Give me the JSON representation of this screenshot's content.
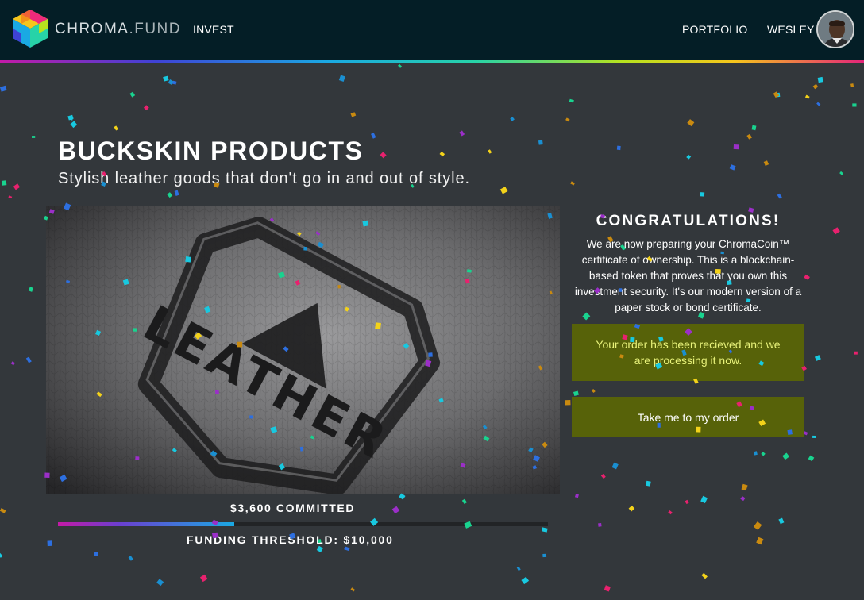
{
  "header": {
    "brand_main": "CHROMA",
    "brand_dot_fund": ".FUND",
    "nav_invest": "INVEST",
    "nav_portfolio": "PORTFOLIO",
    "user_name": "WESLEY"
  },
  "product": {
    "title": "BUCKSKIN PRODUCTS",
    "subtitle": "Stylish leather goods that don't go in and out of style.",
    "image_text": "LEATHER"
  },
  "funding": {
    "committed_label": "$3,600 COMMITTED",
    "threshold_label": "FUNDING THRESHOLD: $10,000",
    "progress_fraction": 0.36
  },
  "panel": {
    "heading": "CONGRATULATIONS!",
    "message": "We are now preparing your ChromaCoin™ certificate of ownership. This is a blockchain-based token that proves that you own this investment security. It's our modern version of a paper stock or bond certificate.",
    "status": "Your order has been recieved and we are processing it now.",
    "button_label": "Take me to my order"
  },
  "colors": {
    "header_bg": "#041e26",
    "page_bg": "#33373b",
    "panel_green": "#576209",
    "status_text": "#e8f27a",
    "confetti": [
      "#19d38f",
      "#1a8fd1",
      "#f3d21a",
      "#9b2fc8",
      "#e8216e",
      "#18c9e0",
      "#c98a10",
      "#2d6fe0"
    ]
  }
}
